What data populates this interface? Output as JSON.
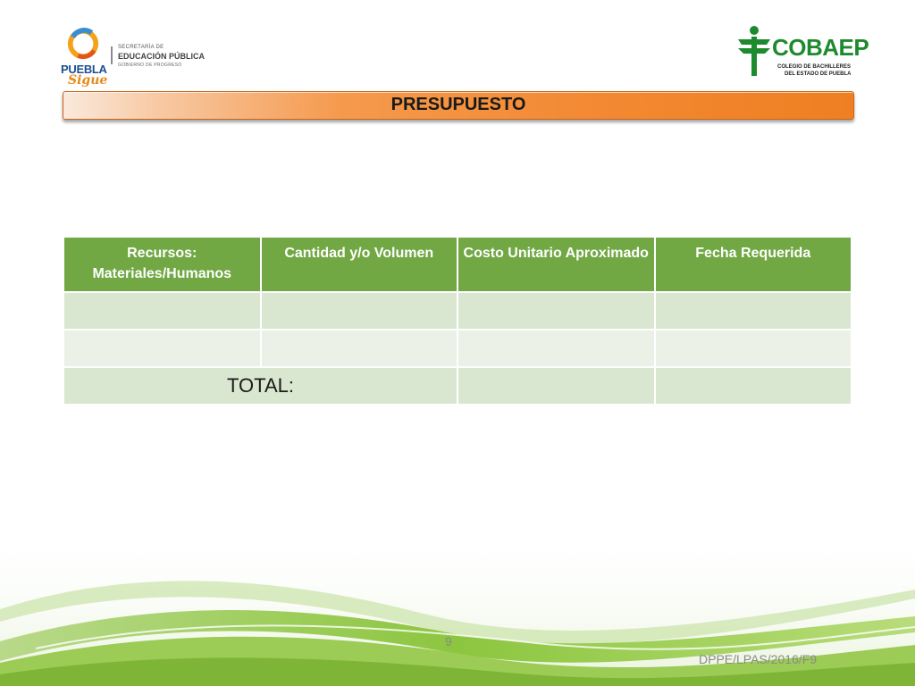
{
  "logos": {
    "left": {
      "brand": "PUEBLA",
      "tagline": "Sigue",
      "org_line1": "SECRETARÍA DE",
      "org_line2": "EDUCACIÓN PÚBLICA",
      "org_line3": "GOBIERNO DE PROGRESO"
    },
    "right": {
      "brand": "COBAEP",
      "sub_line1": "COLEGIO DE BACHILLERES",
      "sub_line2": "DEL ESTADO DE PUEBLA"
    }
  },
  "title": "PRESUPUESTO",
  "table": {
    "headers": [
      "Recursos: Materiales/Humanos",
      "Cantidad y/o Volumen",
      "Costo Unitario Aproximado",
      "Fecha Requerida"
    ],
    "rows": [
      [
        "",
        "",
        "",
        ""
      ],
      [
        "",
        "",
        "",
        ""
      ]
    ],
    "total_label": "TOTAL:"
  },
  "footer": {
    "page_number": "9",
    "doc_code": "DPPE/LPAS/2016/F9"
  },
  "colors": {
    "header_green": "#71a844",
    "row_green": "#d9e6d0",
    "row_green_alt": "#ebf1e6",
    "title_orange": "#f38a34",
    "brand_green": "#1e8a2e"
  }
}
